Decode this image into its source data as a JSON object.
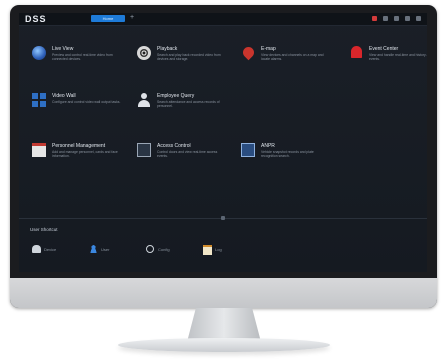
{
  "app": {
    "logo": "DSS",
    "active_tab": "Home",
    "new_tab_symbol": "+"
  },
  "modules": [
    {
      "title": "Live View",
      "description": "Preview and control real-time video from connected devices.",
      "icon": "globe-icon"
    },
    {
      "title": "Playback",
      "description": "Search and play back recorded video from devices and storage.",
      "icon": "film-reel-icon"
    },
    {
      "title": "E-map",
      "description": "View devices and channels on a map and locate alarms.",
      "icon": "map-pin-icon"
    },
    {
      "title": "Event Center",
      "description": "View and handle real-time and history alarm events.",
      "icon": "alarm-light-icon"
    },
    {
      "title": "Video Wall",
      "description": "Configure and control video wall output tasks.",
      "icon": "video-wall-grid-icon"
    },
    {
      "title": "Employee Query",
      "description": "Search attendance and access records of personnel.",
      "icon": "person-icon"
    },
    {
      "title": "Personnel Management",
      "description": "Add and manage personnel, cards and face information.",
      "icon": "calendar-icon"
    },
    {
      "title": "Access Control",
      "description": "Control doors and view real-time access events.",
      "icon": "door-icon"
    },
    {
      "title": "ANPR",
      "description": "Vehicle snapshot records and plate recognition search.",
      "icon": "video-icon"
    }
  ],
  "shortcuts": {
    "title": "User Shortcut",
    "items": [
      {
        "label": "Device",
        "icon": "device-icon"
      },
      {
        "label": "User",
        "icon": "user-icon"
      },
      {
        "label": "Config",
        "icon": "settings-icon"
      },
      {
        "label": "Log",
        "icon": "log-icon"
      }
    ]
  },
  "colors": {
    "screen_bg": "#161b22",
    "accent_blue": "#1e7bd8",
    "alarm_red": "#d9262b"
  }
}
